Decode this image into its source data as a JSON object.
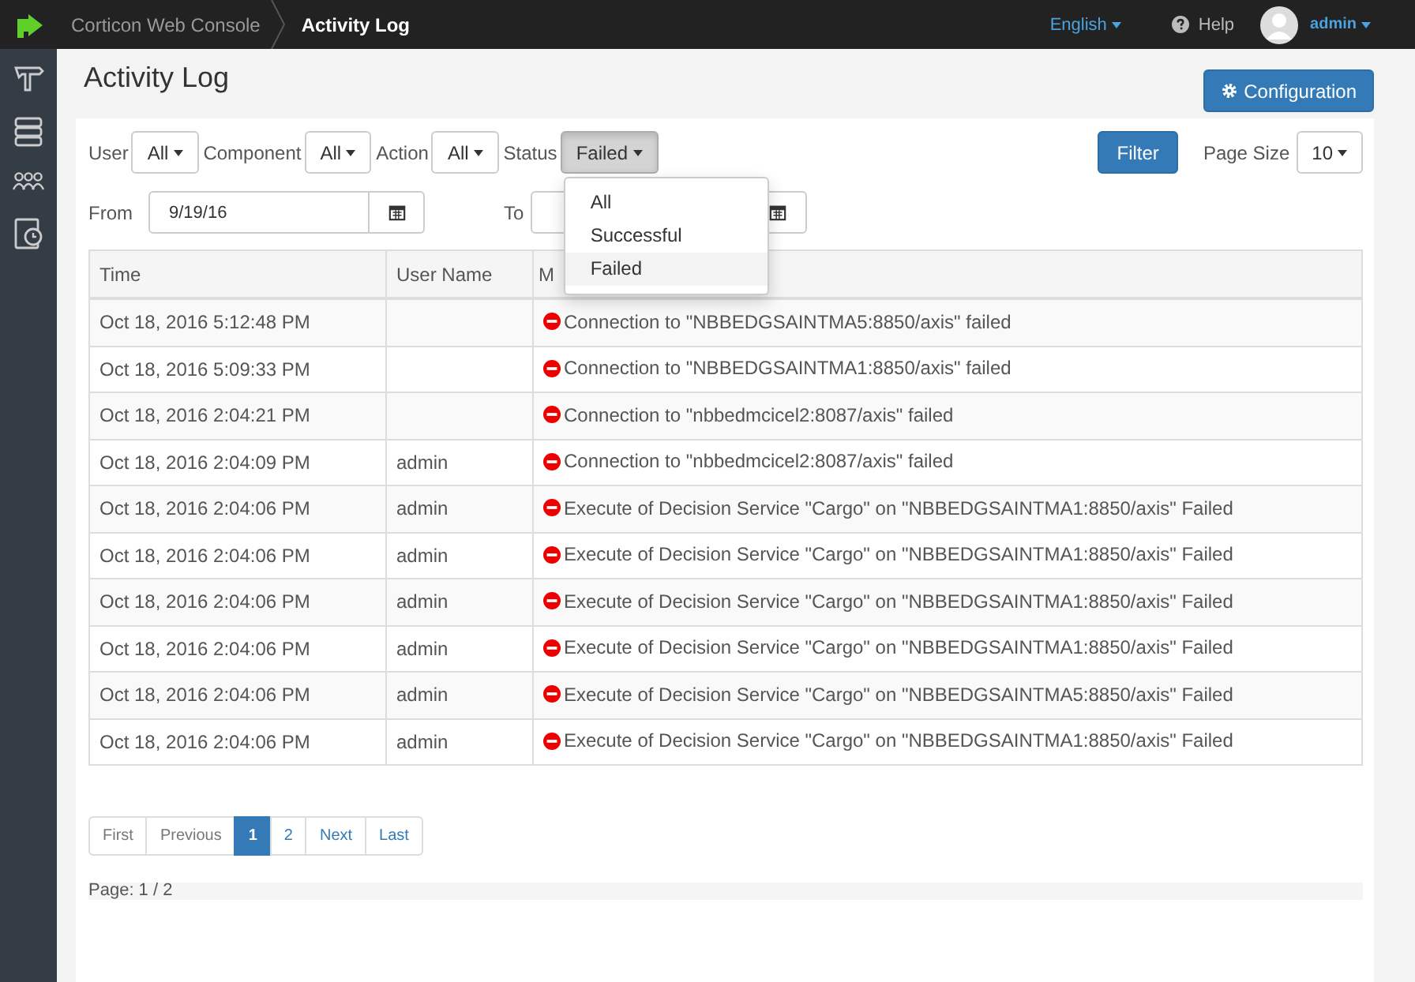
{
  "topbar": {
    "app_name": "Corticon Web Console",
    "page": "Activity Log",
    "language": "English",
    "help": "Help",
    "user": "admin"
  },
  "sidebar": {
    "items": [
      {
        "kind": "signpost"
      },
      {
        "kind": "servers"
      },
      {
        "kind": "users"
      },
      {
        "kind": "log"
      }
    ]
  },
  "title": "Activity Log",
  "config_button": "Configuration",
  "filters": [
    {
      "label": "User",
      "value": "All"
    },
    {
      "label": "Component",
      "value": "All"
    },
    {
      "label": "Action",
      "value": "All"
    },
    {
      "label": "Status",
      "value": "Failed",
      "open": true
    }
  ],
  "status_menu": [
    {
      "label": "All",
      "selected": false
    },
    {
      "label": "Successful",
      "selected": false
    },
    {
      "label": "Failed",
      "selected": true
    }
  ],
  "filter_button": "Filter",
  "page_size": {
    "label": "Page Size",
    "value": "10"
  },
  "from": {
    "label": "From",
    "value": "9/19/16"
  },
  "to": {
    "label": "To"
  },
  "table": {
    "columns": [
      "Time",
      "User Name",
      "M"
    ],
    "rows": [
      {
        "time": "Oct 18, 2016 5:12:48 PM",
        "user": "",
        "message": "Connection to \"NBBEDGSAINTMA5:8850/axis\" failed"
      },
      {
        "time": "Oct 18, 2016 5:09:33 PM",
        "user": "",
        "message": "Connection to \"NBBEDGSAINTMA1:8850/axis\" failed"
      },
      {
        "time": "Oct 18, 2016 2:04:21 PM",
        "user": "",
        "message": "Connection to \"nbbedmcicel2:8087/axis\" failed"
      },
      {
        "time": "Oct 18, 2016 2:04:09 PM",
        "user": "admin",
        "message": "Connection to \"nbbedmcicel2:8087/axis\" failed"
      },
      {
        "time": "Oct 18, 2016 2:04:06 PM",
        "user": "admin",
        "message": "Execute of Decision Service \"Cargo\" on \"NBBEDGSAINTMA1:8850/axis\" Failed"
      },
      {
        "time": "Oct 18, 2016 2:04:06 PM",
        "user": "admin",
        "message": "Execute of Decision Service \"Cargo\" on \"NBBEDGSAINTMA1:8850/axis\" Failed"
      },
      {
        "time": "Oct 18, 2016 2:04:06 PM",
        "user": "admin",
        "message": "Execute of Decision Service \"Cargo\" on \"NBBEDGSAINTMA1:8850/axis\" Failed"
      },
      {
        "time": "Oct 18, 2016 2:04:06 PM",
        "user": "admin",
        "message": "Execute of Decision Service \"Cargo\" on \"NBBEDGSAINTMA1:8850/axis\" Failed"
      },
      {
        "time": "Oct 18, 2016 2:04:06 PM",
        "user": "admin",
        "message": "Execute of Decision Service \"Cargo\" on \"NBBEDGSAINTMA5:8850/axis\" Failed"
      },
      {
        "time": "Oct 18, 2016 2:04:06 PM",
        "user": "admin",
        "message": "Execute of Decision Service \"Cargo\" on \"NBBEDGSAINTMA1:8850/axis\" Failed"
      }
    ]
  },
  "pagination": [
    {
      "label": "First",
      "selected": false
    },
    {
      "label": "Previous",
      "selected": false
    },
    {
      "label": "1",
      "selected": true
    },
    {
      "label": "2",
      "selected": false
    },
    {
      "label": "Next",
      "selected": false
    },
    {
      "label": "Last",
      "selected": false
    }
  ],
  "page_info": "Page: 1 / 2"
}
